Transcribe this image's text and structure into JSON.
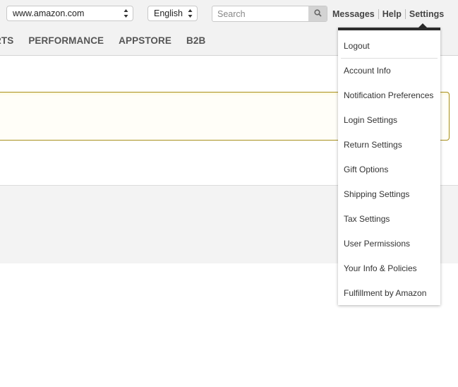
{
  "header": {
    "marketplace_select": {
      "value": "www.amazon.com"
    },
    "language_select": {
      "value": "English"
    },
    "search": {
      "placeholder": "Search",
      "icon": "search-icon"
    },
    "links": [
      {
        "label": "Messages"
      },
      {
        "label": "Help"
      },
      {
        "label": "Settings"
      }
    ]
  },
  "nav": {
    "items": [
      {
        "label": "RTS"
      },
      {
        "label": "PERFORMANCE"
      },
      {
        "label": "APPSTORE"
      },
      {
        "label": "B2B"
      }
    ]
  },
  "settings_menu": {
    "items": [
      {
        "label": "Logout"
      },
      {
        "label": "Account Info"
      },
      {
        "label": "Notification Preferences"
      },
      {
        "label": "Login Settings"
      },
      {
        "label": "Return Settings"
      },
      {
        "label": "Gift Options"
      },
      {
        "label": "Shipping Settings"
      },
      {
        "label": "Tax Settings"
      },
      {
        "label": "User Permissions"
      },
      {
        "label": "Your Info & Policies"
      },
      {
        "label": "Fulfillment by Amazon"
      }
    ]
  },
  "colors": {
    "alert_border": "#a8901e",
    "menu_top_border": "#2b2b2b",
    "header_bg": "#f2f2f2"
  }
}
